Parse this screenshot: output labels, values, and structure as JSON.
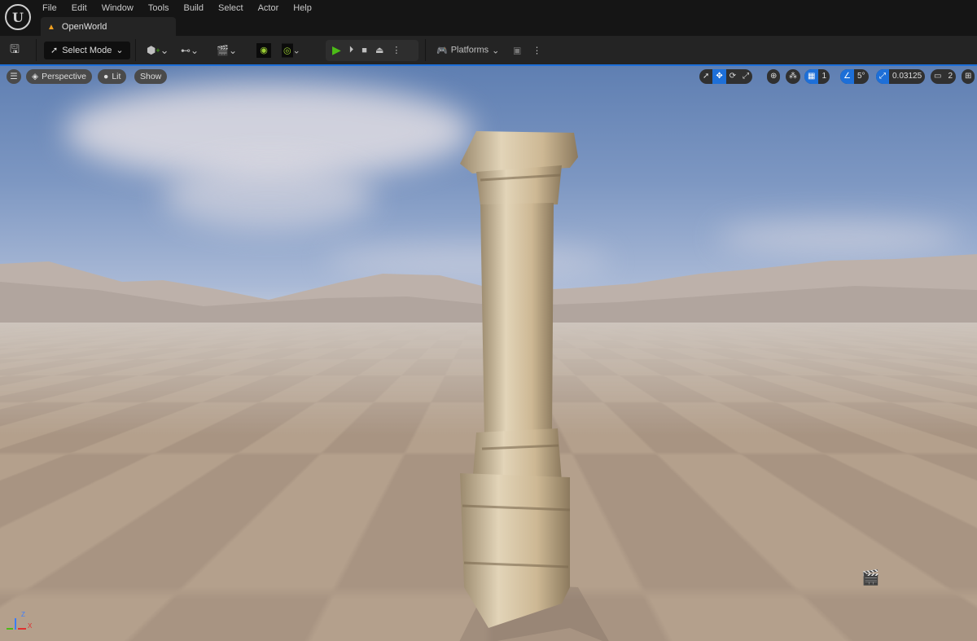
{
  "menu": [
    "File",
    "Edit",
    "Window",
    "Tools",
    "Build",
    "Select",
    "Actor",
    "Help"
  ],
  "tab": {
    "label": "OpenWorld"
  },
  "toolbar": {
    "select_mode": "Select Mode",
    "platforms": "Platforms"
  },
  "viewport": {
    "perspective": "Perspective",
    "lit": "Lit",
    "show": "Show",
    "grid_snap": "1",
    "rotation_snap": "5°",
    "scale_snap": "0.03125",
    "camera_speed": "2",
    "axis_z": "Z",
    "axis_x": "X"
  },
  "colors": {
    "accent": "#1d6fd8",
    "play": "#4cbb17",
    "background": "#151515",
    "toolbar": "#242424"
  }
}
